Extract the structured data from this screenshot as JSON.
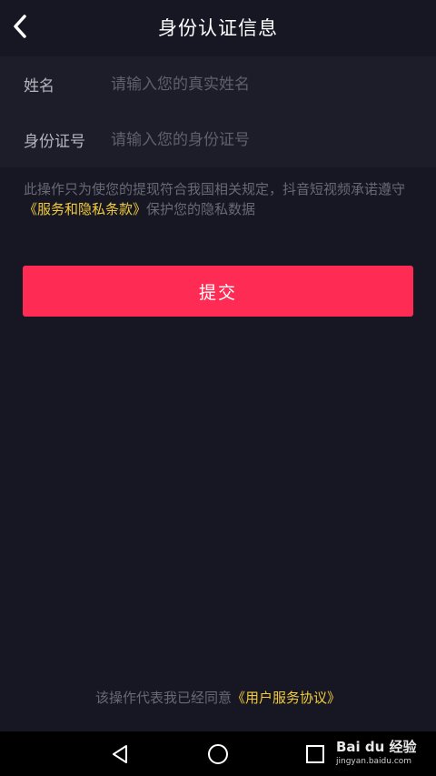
{
  "header": {
    "title": "身份认证信息",
    "back_icon": "chevron-left-icon"
  },
  "form": {
    "name_label": "姓名",
    "name_placeholder": "请输入您的真实姓名",
    "name_value": "",
    "id_label": "身份证号",
    "id_placeholder": "请输入您的身份证号",
    "id_value": ""
  },
  "notice": {
    "text_before": "此操作只为使您的提现符合我国相关规定，抖音短视频承诺遵守",
    "link": "《服务和隐私条款》",
    "text_after": "保护您的隐私数据"
  },
  "submit": {
    "label": "提交"
  },
  "agreement": {
    "text": "该操作代表我已经同意",
    "link": "《用户服务协议》"
  },
  "navbar": {
    "back_icon": "triangle-back-icon",
    "home_icon": "circle-home-icon",
    "recent_icon": "square-recent-icon"
  },
  "watermark": {
    "brand": "Bai du 经验",
    "url": "jingyan.baidu.com"
  },
  "colors": {
    "background": "#161722",
    "form_background": "#1c1d29",
    "accent": "#fe2c55",
    "link": "#f2cb3b",
    "muted_text": "#676975"
  }
}
